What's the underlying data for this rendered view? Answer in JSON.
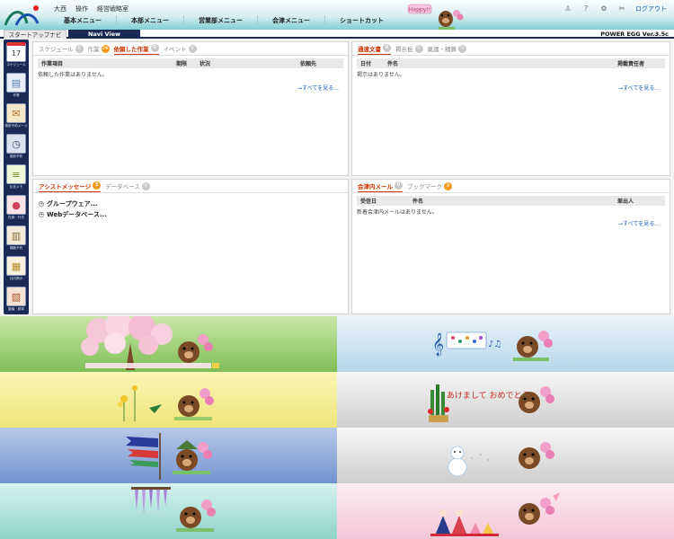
{
  "header": {
    "user_name": "大西",
    "user_action": "操作",
    "department": "経営戦略室",
    "menus": [
      "基本メニュー",
      "本部メニュー",
      "営業部メニュー",
      "会津メニュー",
      "ショートカット"
    ],
    "logout": "ログアウト",
    "icons": [
      "person-icon",
      "help-icon",
      "gear-icon",
      "tool-icon"
    ],
    "mascot_sign": "Happy!!"
  },
  "nav": {
    "tabs": [
      "スタートアップナビ",
      "Navi View"
    ],
    "active_tab": "Navi View",
    "version": "POWER EGG Ver.3.5c"
  },
  "sidebar": {
    "items": [
      {
        "label": "スケジュール",
        "icon": "calendar-icon",
        "glyph": "17"
      },
      {
        "label": "作業",
        "icon": "clipboard-icon",
        "glyph": "▤"
      },
      {
        "label": "施設予約メール",
        "icon": "envelope-icon",
        "glyph": "✉"
      },
      {
        "label": "施設予約",
        "icon": "clock-icon",
        "glyph": "◷"
      },
      {
        "label": "伝言メモ",
        "icon": "memo-icon",
        "glyph": "≡"
      },
      {
        "label": "在席・行先",
        "icon": "pin-icon",
        "glyph": "●"
      },
      {
        "label": "機器予約",
        "icon": "book-icon",
        "glyph": "▥"
      },
      {
        "label": "社内掲示",
        "icon": "board-icon",
        "glyph": "▦"
      },
      {
        "label": "稟議・精算",
        "icon": "folder-icon",
        "glyph": "▧"
      }
    ]
  },
  "panel_work": {
    "tabs": [
      {
        "label": "スケジュール",
        "badge": "0"
      },
      {
        "label": "作業",
        "badge": "24"
      },
      {
        "label": "依頼した作業",
        "badge": "0"
      },
      {
        "label": "イベント",
        "badge": "0"
      }
    ],
    "active_tab": "依頼した作業",
    "columns": [
      "作業項目",
      "期限",
      "状況",
      "依頼先"
    ],
    "empty_message": "依頼した作業はありません。",
    "see_all": "→すべてを見る..."
  },
  "panel_notice": {
    "tabs": [
      {
        "label": "通達文書",
        "badge": "0"
      },
      {
        "label": "掲示板",
        "badge": "0"
      },
      {
        "label": "稟議・精算",
        "badge": "0"
      }
    ],
    "active_tab": "通達文書",
    "columns": [
      "日付",
      "件名",
      "掲載責任者"
    ],
    "empty_message": "掲示はありません。",
    "see_all": "→すべてを見る..."
  },
  "panel_assist": {
    "tabs": [
      {
        "label": "アシストメッセージ",
        "badge": "3"
      },
      {
        "label": "データベース",
        "badge": "0"
      }
    ],
    "active_tab": "アシストメッセージ",
    "tree": [
      "グループウェア...",
      "Webデータベース..."
    ]
  },
  "panel_mail": {
    "tabs": [
      {
        "label": "会津内メール",
        "badge": "0"
      },
      {
        "label": "ブックマーク",
        "badge": "9"
      }
    ],
    "active_tab": "会津内メール",
    "columns": [
      "受信日",
      "件名",
      "差出人"
    ],
    "empty_message": "新着会津内メールはありません。",
    "see_all": "→すべてを見る..."
  },
  "banners": [
    {
      "theme": "spring-cherry-blossom",
      "colors": [
        "#c9e7a9",
        "#7fbf56"
      ]
    },
    {
      "theme": "music-notes",
      "colors": [
        "#eaf4fa",
        "#b5d6ea"
      ]
    },
    {
      "theme": "rapeseed-flowers",
      "colors": [
        "#faf6b5",
        "#efe47a"
      ]
    },
    {
      "theme": "new-year-kadomatsu",
      "colors": [
        "#f6f6f6",
        "#cfcfcf"
      ],
      "text": "あけまして おめでとう!"
    },
    {
      "theme": "carp-streamer",
      "colors": [
        "#b6c9ea",
        "#7393cf"
      ]
    },
    {
      "theme": "snowman",
      "colors": [
        "#f8f8f8",
        "#cdcdcd"
      ]
    },
    {
      "theme": "wisteria",
      "colors": [
        "#d7f3ef",
        "#8fd3cb"
      ]
    },
    {
      "theme": "hina-dolls",
      "colors": [
        "#fcecf2",
        "#f4c6d8"
      ]
    }
  ]
}
